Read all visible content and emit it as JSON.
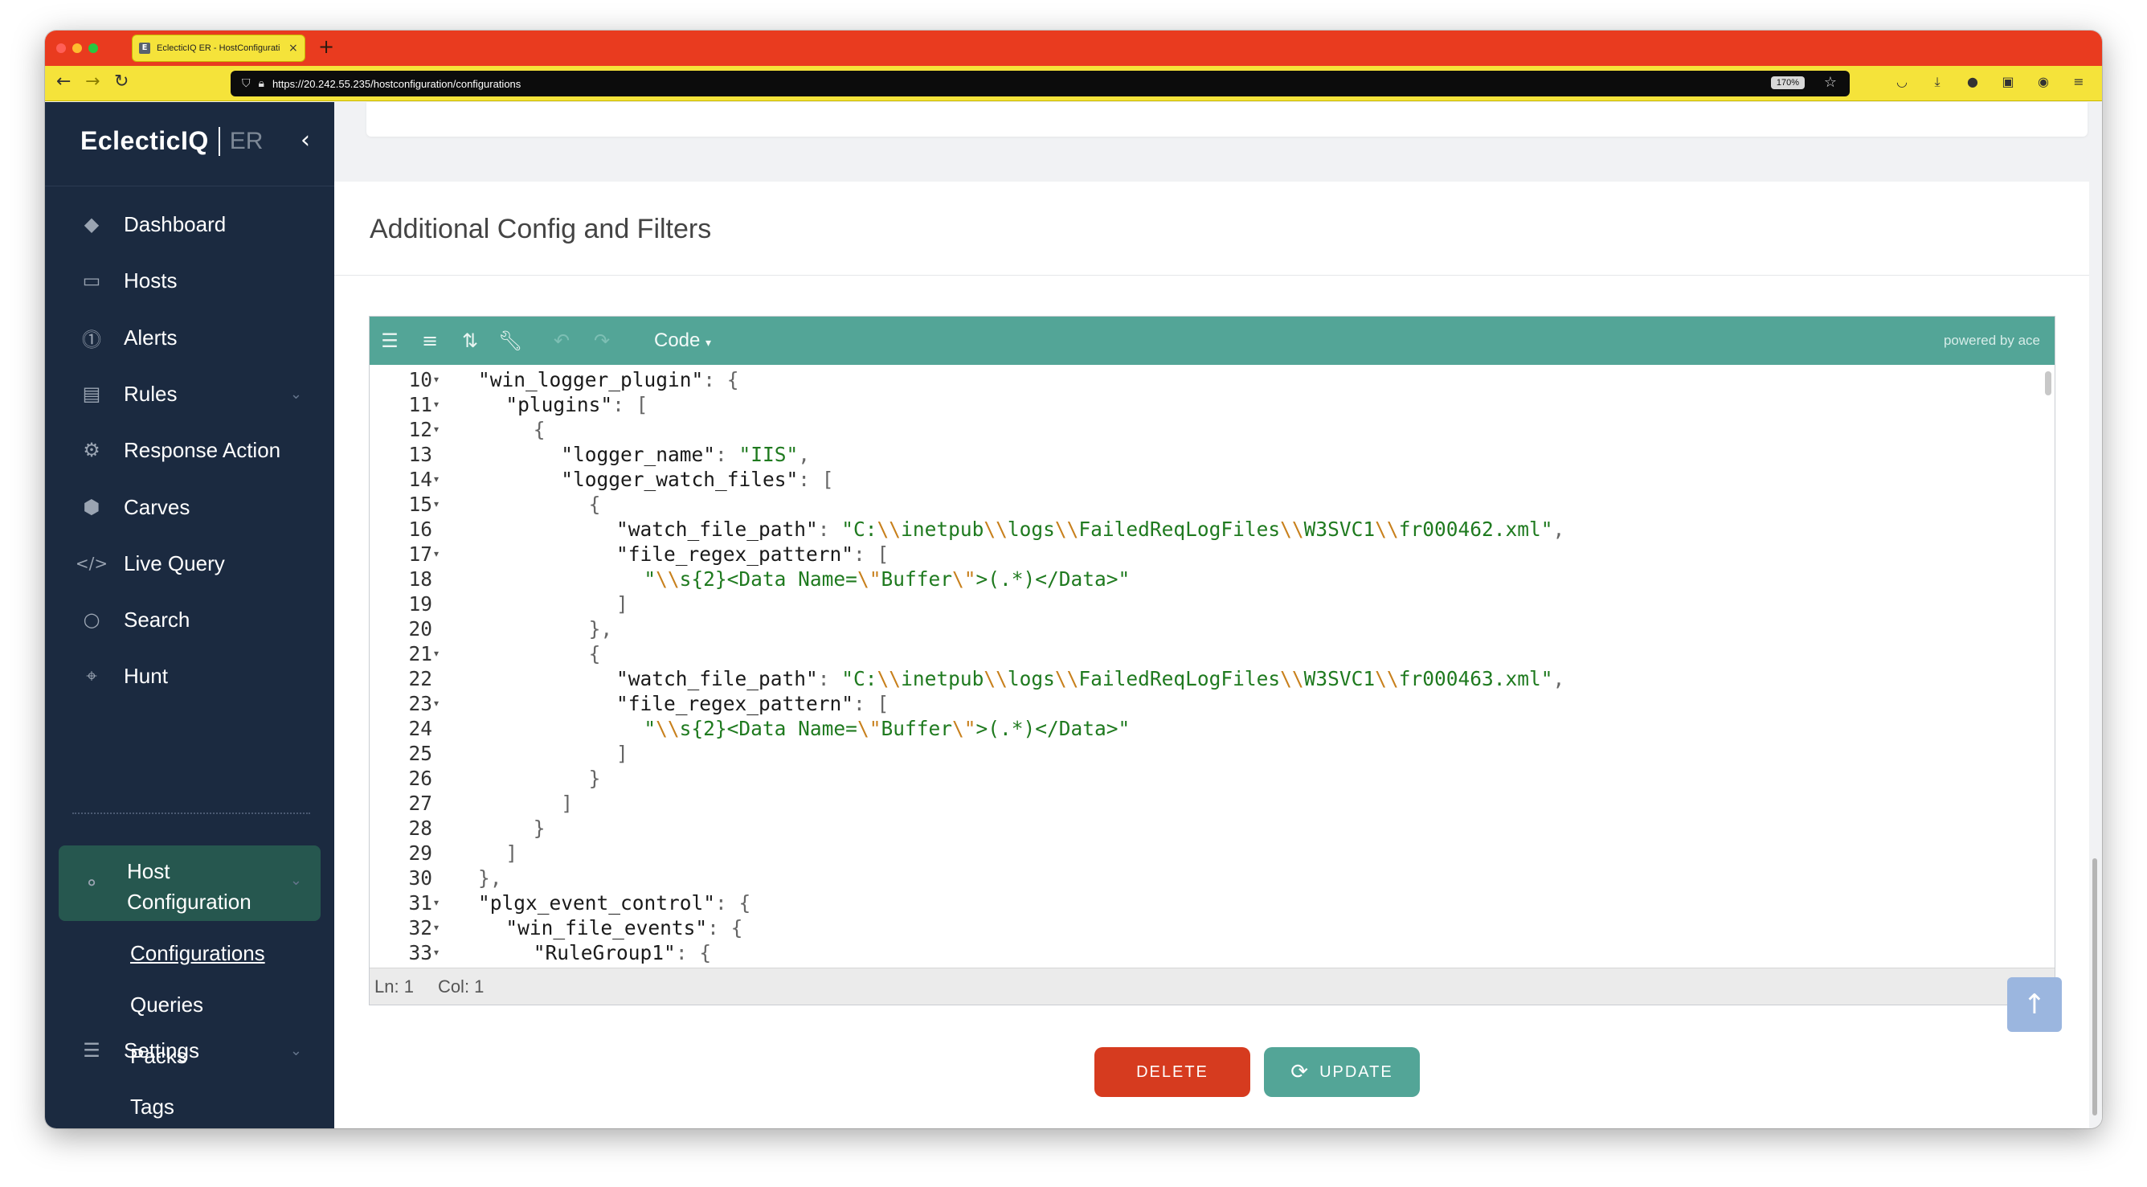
{
  "browser": {
    "tab_title": "EclecticIQ ER - HostConfigurati",
    "tab_favicon": "E",
    "tab_close": "×",
    "new_tab": "+",
    "url": "https://20.242.55.235/hostconfiguration/configurations",
    "zoom": "170%",
    "colors": {
      "tabbar": "#e93b1f",
      "navbar": "#f5e33a"
    }
  },
  "sidebar": {
    "brand": "EclecticIQ",
    "brand_suffix": "ER",
    "items": [
      {
        "label": "Dashboard",
        "icon": "layers-icon"
      },
      {
        "label": "Hosts",
        "icon": "monitor-icon"
      },
      {
        "label": "Alerts",
        "icon": "alert-icon"
      },
      {
        "label": "Rules",
        "icon": "clipboard-icon"
      },
      {
        "label": "Response Action",
        "icon": "gear-icon"
      },
      {
        "label": "Carves",
        "icon": "hexagon-icon"
      },
      {
        "label": "Live Query",
        "icon": "code-icon"
      },
      {
        "label": "Search",
        "icon": "search-icon"
      },
      {
        "label": "Hunt",
        "icon": "crosshair-icon"
      }
    ],
    "active_section": "Host Configuration",
    "sub_items": [
      "Configurations",
      "Queries",
      "Packs",
      "Tags"
    ],
    "settings": "Settings"
  },
  "main": {
    "section_title": "Additional Config and Filters",
    "editor": {
      "mode": "Code",
      "powered_by": "powered by ace",
      "status_ln": "Ln: 1",
      "status_col": "Col: 1",
      "lines": [
        {
          "n": "10",
          "fold": true
        },
        {
          "n": "11",
          "fold": true
        },
        {
          "n": "12",
          "fold": true
        },
        {
          "n": "13",
          "fold": false
        },
        {
          "n": "14",
          "fold": true
        },
        {
          "n": "15",
          "fold": true
        },
        {
          "n": "16",
          "fold": false
        },
        {
          "n": "17",
          "fold": true
        },
        {
          "n": "18",
          "fold": false
        },
        {
          "n": "19",
          "fold": false
        },
        {
          "n": "20",
          "fold": false
        },
        {
          "n": "21",
          "fold": true
        },
        {
          "n": "22",
          "fold": false
        },
        {
          "n": "23",
          "fold": true
        },
        {
          "n": "24",
          "fold": false
        },
        {
          "n": "25",
          "fold": false
        },
        {
          "n": "26",
          "fold": false
        },
        {
          "n": "27",
          "fold": false
        },
        {
          "n": "28",
          "fold": false
        },
        {
          "n": "29",
          "fold": false
        },
        {
          "n": "30",
          "fold": false
        },
        {
          "n": "31",
          "fold": true
        },
        {
          "n": "32",
          "fold": true
        },
        {
          "n": "33",
          "fold": true
        }
      ],
      "code": {
        "l10_key": "\"win_logger_plugin\"",
        "l11_key": "\"plugins\"",
        "l13_key": "\"logger_name\"",
        "l13_val": "\"IIS\"",
        "l14_key": "\"logger_watch_files\"",
        "watch_key": "\"watch_file_path\"",
        "path_parts": [
          "\"C:",
          "\\\\",
          "inetpub",
          "\\\\",
          "logs",
          "\\\\",
          "FailedReqLogFiles",
          "\\\\",
          "W3SVC1",
          "\\\\"
        ],
        "l16_file": "fr000462.xml\"",
        "l22_file": "fr000463.xml\"",
        "regex_key": "\"file_regex_pattern\"",
        "regex_parts": [
          "\"",
          "\\\\",
          "s{2}<Data Name=",
          "\\\"",
          "Buffer",
          "\\\"",
          ">(.*)</Data>\""
        ],
        "l31_key": "\"plgx_event_control\"",
        "l32_key": "\"win_file_events\"",
        "l33_key": "\"RuleGroup1\""
      }
    },
    "buttons": {
      "delete": "DELETE",
      "update": "UPDATE"
    },
    "colors": {
      "accent": "#53a597",
      "danger": "#d63b1f",
      "sidebar": "#1b2a40"
    }
  }
}
